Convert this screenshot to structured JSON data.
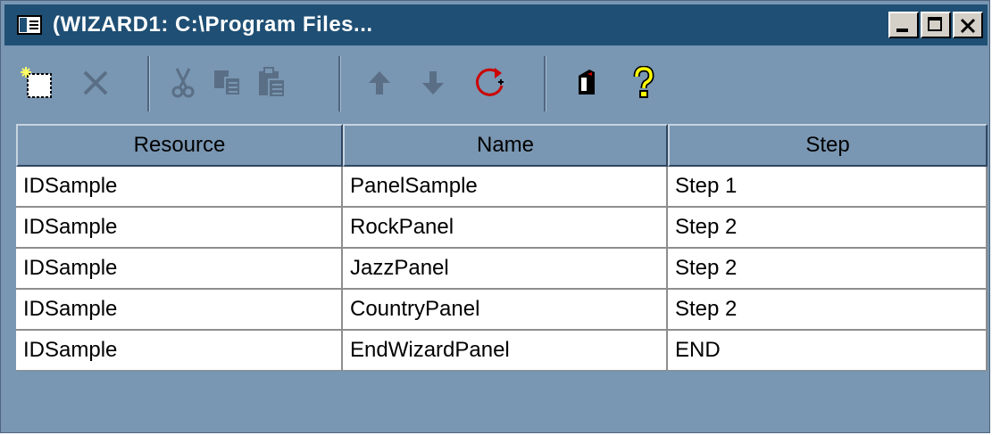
{
  "window": {
    "title": "(WIZARD1: C:\\Program Files..."
  },
  "toolbar": {
    "buttons": [
      "new-icon",
      "delete-icon",
      "cut-icon",
      "copy-icon",
      "paste-icon",
      "move-up-icon",
      "move-down-icon",
      "refresh-icon",
      "preview-icon",
      "help-icon"
    ]
  },
  "table": {
    "columns": [
      "Resource",
      "Name",
      "Step"
    ],
    "rows": [
      [
        "IDSample",
        "PanelSample",
        "Step 1"
      ],
      [
        "IDSample",
        "RockPanel",
        "Step 2"
      ],
      [
        "IDSample",
        "JazzPanel",
        "Step 2"
      ],
      [
        "IDSample",
        "CountryPanel",
        "Step 2"
      ],
      [
        "IDSample",
        "EndWizardPanel",
        "END"
      ]
    ]
  },
  "colors": {
    "titlebar": "#1f4f74",
    "window_bg": "#7996b2",
    "disabled_icon": "#5a6f86",
    "help_yellow": "#ffff00"
  }
}
